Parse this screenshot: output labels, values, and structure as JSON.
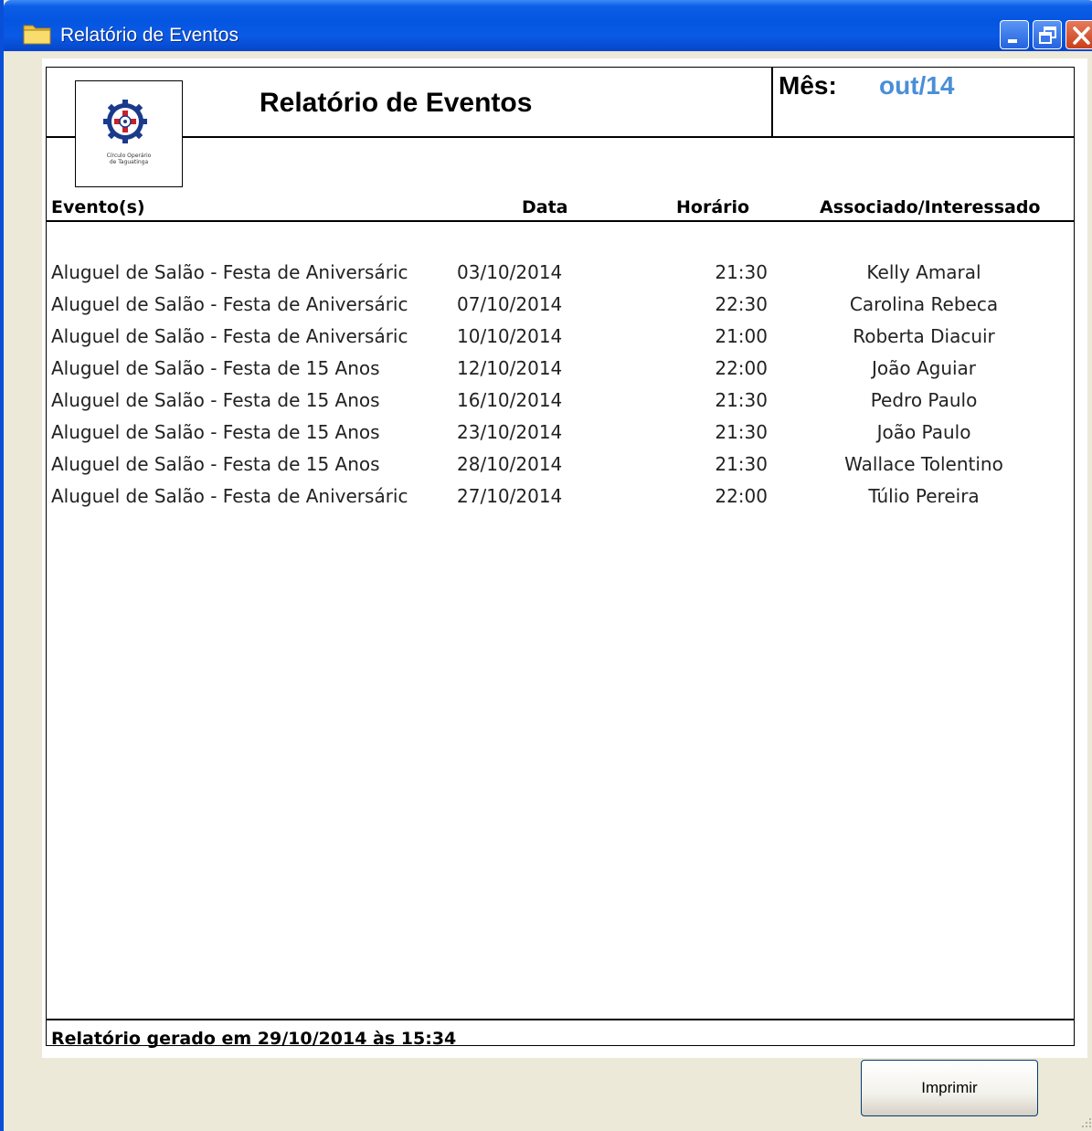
{
  "window": {
    "title": "Relatório de Eventos"
  },
  "report": {
    "title": "Relatório de Eventos",
    "month_label": "Mês:",
    "month_value": "out/14",
    "logo": {
      "icon": "gear-cross-emblem",
      "caption_line1": "Círculo Operário",
      "caption_line2": "de Taguatinga"
    },
    "columns": {
      "event": "Evento(s)",
      "date": "Data",
      "time": "Horário",
      "person": "Associado/Interessado"
    },
    "rows": [
      {
        "event": "Aluguel de Salão - Festa de Aniversáric",
        "date": "03/10/2014",
        "time": "21:30",
        "person": "Kelly Amaral"
      },
      {
        "event": "Aluguel de Salão - Festa de Aniversáric",
        "date": "07/10/2014",
        "time": "22:30",
        "person": "Carolina Rebeca"
      },
      {
        "event": "Aluguel de Salão - Festa de Aniversáric",
        "date": "10/10/2014",
        "time": "21:00",
        "person": "Roberta Diacuir"
      },
      {
        "event": "Aluguel de Salão - Festa de 15 Anos",
        "date": "12/10/2014",
        "time": "22:00",
        "person": "João Aguiar"
      },
      {
        "event": "Aluguel de Salão - Festa de 15 Anos",
        "date": "16/10/2014",
        "time": "21:30",
        "person": "Pedro Paulo"
      },
      {
        "event": "Aluguel de Salão - Festa de 15 Anos",
        "date": "23/10/2014",
        "time": "21:30",
        "person": "João Paulo"
      },
      {
        "event": "Aluguel de Salão - Festa de 15 Anos",
        "date": "28/10/2014",
        "time": "21:30",
        "person": "Wallace Tolentino"
      },
      {
        "event": "Aluguel de Salão - Festa de Aniversáric",
        "date": "27/10/2014",
        "time": "22:00",
        "person": "Túlio Pereira"
      }
    ],
    "footer": "Relatório gerado em 29/10/2014 às 15:34"
  },
  "actions": {
    "print_label": "Imprimir"
  },
  "colors": {
    "titlebar": "#0455e0",
    "month_value": "#4a8ed8",
    "background": "#ece9d8"
  }
}
